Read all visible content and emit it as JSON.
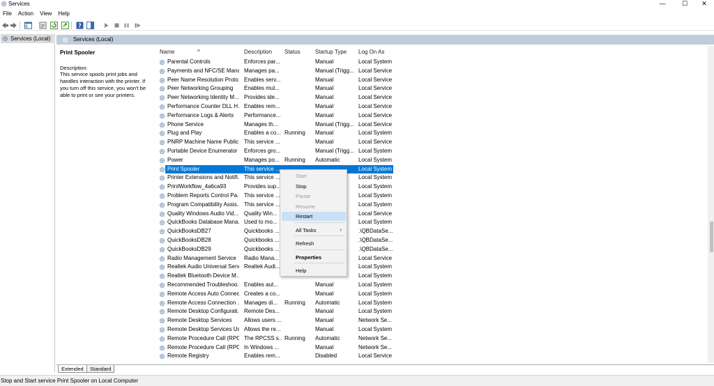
{
  "window": {
    "title": "Services"
  },
  "window_controls": {
    "minimize": "—",
    "maximize": "☐",
    "close": "✕"
  },
  "menu": [
    "File",
    "Action",
    "View",
    "Help"
  ],
  "tree": {
    "root_label": "Services (Local)"
  },
  "pane_header": "Services (Local)",
  "description": {
    "title": "Print Spooler",
    "label": "Description:",
    "text": "This service spools print jobs and handles interaction with the printer. If you turn off this service, you won't be able to print or see your printers."
  },
  "columns": [
    "Name",
    "Description",
    "Status",
    "Startup Type",
    "Log On As"
  ],
  "rows": [
    {
      "name": "Parental Controls",
      "desc": "Enforces par...",
      "status": "",
      "startup": "Manual",
      "logon": "Local System"
    },
    {
      "name": "Payments and NFC/SE Mana...",
      "desc": "Manages pa...",
      "status": "",
      "startup": "Manual (Trigg...",
      "logon": "Local Service"
    },
    {
      "name": "Peer Name Resolution Proto...",
      "desc": "Enables serv...",
      "status": "",
      "startup": "Manual",
      "logon": "Local Service"
    },
    {
      "name": "Peer Networking Grouping",
      "desc": "Enables mul...",
      "status": "",
      "startup": "Manual",
      "logon": "Local Service"
    },
    {
      "name": "Peer Networking Identity M...",
      "desc": "Provides ide...",
      "status": "",
      "startup": "Manual",
      "logon": "Local Service"
    },
    {
      "name": "Performance Counter DLL H...",
      "desc": "Enables rem...",
      "status": "",
      "startup": "Manual",
      "logon": "Local Service"
    },
    {
      "name": "Performance Logs & Alerts",
      "desc": "Performance...",
      "status": "",
      "startup": "Manual",
      "logon": "Local Service"
    },
    {
      "name": "Phone Service",
      "desc": "Manages th...",
      "status": "",
      "startup": "Manual (Trigg...",
      "logon": "Local Service"
    },
    {
      "name": "Plug and Play",
      "desc": "Enables a co...",
      "status": "Running",
      "startup": "Manual",
      "logon": "Local System"
    },
    {
      "name": "PNRP Machine Name Public...",
      "desc": "This service ...",
      "status": "",
      "startup": "Manual",
      "logon": "Local Service"
    },
    {
      "name": "Portable Device Enumerator ...",
      "desc": "Enforces gro...",
      "status": "",
      "startup": "Manual (Trigg...",
      "logon": "Local System"
    },
    {
      "name": "Power",
      "desc": "Manages po...",
      "status": "Running",
      "startup": "Automatic",
      "logon": "Local System"
    },
    {
      "name": "Print Spooler",
      "desc": "This service ...",
      "status": "",
      "startup": "",
      "logon": "Local System"
    },
    {
      "name": "Printer Extensions and Notifi...",
      "desc": "This service ...",
      "status": "",
      "startup": "",
      "logon": "Local System"
    },
    {
      "name": "PrintWorkflow_4a6ca93",
      "desc": "Provides sup...",
      "status": "",
      "startup": "",
      "logon": "Local System"
    },
    {
      "name": "Problem Reports Control Pa...",
      "desc": "This service ...",
      "status": "",
      "startup": "",
      "logon": "Local System"
    },
    {
      "name": "Program Compatibility Assis...",
      "desc": "This service ...",
      "status": "",
      "startup": "",
      "logon": "Local System"
    },
    {
      "name": "Quality Windows Audio Vid...",
      "desc": "Quality Win...",
      "status": "",
      "startup": "",
      "logon": "Local Service"
    },
    {
      "name": "QuickBooks Database Mana...",
      "desc": "Used to mo...",
      "status": "",
      "startup": "",
      "logon": "Local System"
    },
    {
      "name": "QuickBooksDB27",
      "desc": "Quickbooks ...",
      "status": "",
      "startup": "",
      "logon": ".\\QBDataSe..."
    },
    {
      "name": "QuickBooksDB28",
      "desc": "Quickbooks ...",
      "status": "",
      "startup": "",
      "logon": ".\\QBDataSe..."
    },
    {
      "name": "QuickBooksDB29",
      "desc": "Quickbooks ...",
      "status": "",
      "startup": "",
      "logon": ".\\QBDataSe..."
    },
    {
      "name": "Radio Management Service",
      "desc": "Radio Mana...",
      "status": "",
      "startup": "",
      "logon": "Local Service"
    },
    {
      "name": "Realtek Audio Universal Serv...",
      "desc": "Realtek Audi...",
      "status": "",
      "startup": "",
      "logon": "Local System"
    },
    {
      "name": "Realtek Bluetooth Device M...",
      "desc": "",
      "status": "",
      "startup": "",
      "logon": "Local System"
    },
    {
      "name": "Recommended Troubleshoo...",
      "desc": "Enables aut...",
      "status": "",
      "startup": "Manual",
      "logon": "Local System"
    },
    {
      "name": "Remote Access Auto Connec...",
      "desc": "Creates a co...",
      "status": "",
      "startup": "Manual",
      "logon": "Local System"
    },
    {
      "name": "Remote Access Connection ...",
      "desc": "Manages di...",
      "status": "Running",
      "startup": "Automatic",
      "logon": "Local System"
    },
    {
      "name": "Remote Desktop Configurati...",
      "desc": "Remote Des...",
      "status": "",
      "startup": "Manual",
      "logon": "Local System"
    },
    {
      "name": "Remote Desktop Services",
      "desc": "Allows users ...",
      "status": "",
      "startup": "Manual",
      "logon": "Network Se..."
    },
    {
      "name": "Remote Desktop Services Us...",
      "desc": "Allows the re...",
      "status": "",
      "startup": "Manual",
      "logon": "Local System"
    },
    {
      "name": "Remote Procedure Call (RPC)",
      "desc": "The RPCSS s...",
      "status": "Running",
      "startup": "Automatic",
      "logon": "Network Se..."
    },
    {
      "name": "Remote Procedure Call (RPC)...",
      "desc": "In Windows ...",
      "status": "",
      "startup": "Manual",
      "logon": "Network Se..."
    },
    {
      "name": "Remote Registry",
      "desc": "Enables rem...",
      "status": "",
      "startup": "Disabled",
      "logon": "Local Service"
    }
  ],
  "context_menu": [
    {
      "label": "Start",
      "state": "disabled"
    },
    {
      "label": "Stop",
      "state": "normal"
    },
    {
      "label": "Pause",
      "state": "disabled"
    },
    {
      "label": "Resume",
      "state": "disabled"
    },
    {
      "label": "Restart",
      "state": "hover"
    },
    {
      "label": "All Tasks",
      "state": "submenu"
    },
    {
      "label": "Refresh",
      "state": "normal"
    },
    {
      "label": "Properties",
      "state": "bold"
    },
    {
      "label": "Help",
      "state": "normal"
    }
  ],
  "submenu_arrow": "›",
  "tabs": [
    "Extended",
    "Standard"
  ],
  "status_bar": "Stop and Start service Print Spooler on Local Computer",
  "colors": {
    "selection": "#0078d7",
    "header_band": "#bfcddb",
    "menu_hover": "#c9e0f7"
  },
  "selected_row_index": 12
}
